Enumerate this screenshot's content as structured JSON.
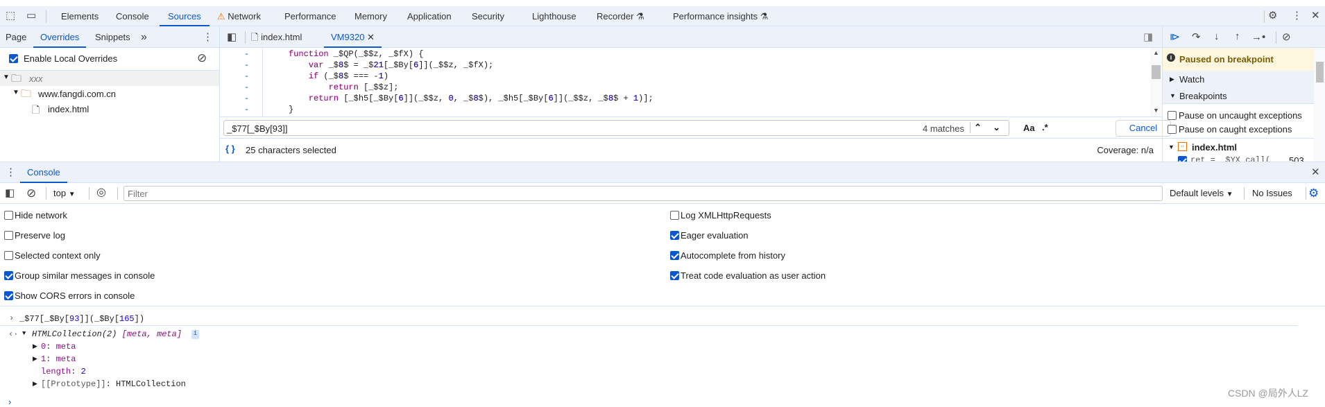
{
  "main_tabs": [
    {
      "label": "Elements"
    },
    {
      "label": "Console"
    },
    {
      "label": "Sources",
      "active": true
    },
    {
      "label": "Network",
      "icon": "warning-icon"
    },
    {
      "label": "Performance"
    },
    {
      "label": "Memory"
    },
    {
      "label": "Application"
    },
    {
      "label": "Security"
    },
    {
      "label": "Lighthouse"
    },
    {
      "label": "Recorder",
      "icon": "flask-icon"
    },
    {
      "label": "Performance insights",
      "icon": "flask-icon"
    }
  ],
  "navigator": {
    "tabs": [
      {
        "label": "Page"
      },
      {
        "label": "Overrides",
        "active": true
      },
      {
        "label": "Snippets"
      },
      {
        "label": "»"
      }
    ],
    "enable_overrides": {
      "label": "Enable Local Overrides",
      "checked": true
    },
    "tree": [
      {
        "label": "xxx"
      },
      {
        "label": "www.fangdi.com.cn"
      },
      {
        "label": "index.html"
      }
    ]
  },
  "editor": {
    "tabs": [
      {
        "label": "index.html"
      },
      {
        "label": "VM9320",
        "active": true
      }
    ],
    "gutter_mark": "-",
    "lines": [
      "function _$QP(_$$z, _$fX) {",
      "    var _$8$ = _$21[_$By[6]](_$$z, _$fX);",
      "    if (_$8$ === -1)",
      "        return [_$$z];",
      "    return [_$h5[_$By[6]](_$$z, 0, _$8$), _$h5[_$By[6]](_$$z, _$8$ + 1)];",
      "}"
    ],
    "search": {
      "value": "_$77[_$By[93]]",
      "matches": "4 matches",
      "case_label": "Aa",
      "regex_label": ".*",
      "cancel": "Cancel"
    },
    "status": {
      "selection": "25 characters selected",
      "coverage": "Coverage: n/a"
    }
  },
  "debugger": {
    "paused": "Paused on breakpoint",
    "watch": "Watch",
    "breakpoints": "Breakpoints",
    "pause_uncaught": {
      "label": "Pause on uncaught exceptions",
      "checked": false
    },
    "pause_caught": {
      "label": "Pause on caught exceptions",
      "checked": false
    },
    "file": "index.html",
    "bp_line": {
      "code": "ret = _$YX_call(",
      "line": "503",
      "checked": true
    }
  },
  "drawer": {
    "tab": "Console"
  },
  "console": {
    "context": "top",
    "filter_placeholder": "Filter",
    "levels": "Default levels",
    "issues": "No Issues",
    "settings_left": [
      {
        "label": "Hide network",
        "checked": false
      },
      {
        "label": "Preserve log",
        "checked": false
      },
      {
        "label": "Selected context only",
        "checked": false
      },
      {
        "label": "Group similar messages in console",
        "checked": true
      },
      {
        "label": "Show CORS errors in console",
        "checked": true
      }
    ],
    "settings_right": [
      {
        "label": "Log XMLHttpRequests",
        "checked": false
      },
      {
        "label": "Eager evaluation",
        "checked": true
      },
      {
        "label": "Autocomplete from history",
        "checked": true
      },
      {
        "label": "Treat code evaluation as user action",
        "checked": true
      }
    ],
    "input": {
      "a": "_$77[_$By[",
      "b": "93",
      "c": "]](_$By[",
      "d": "165",
      "e": "])"
    },
    "result": {
      "head": "HTMLCollection(2) ",
      "items": "[meta, meta]",
      "info": "i",
      "rows": [
        {
          "k": "0",
          "v": "meta"
        },
        {
          "k": "1",
          "v": "meta"
        },
        {
          "k": "length",
          "v": "2"
        },
        {
          "k": "[[Prototype]]",
          "v": "HTMLCollection"
        }
      ]
    }
  },
  "watermark": "CSDN @局外人LZ",
  "colors": {
    "accent": "#0b57d0",
    "keyword": "#aa0d91",
    "number": "#1c00cf",
    "paused_bg": "#fef7e0"
  }
}
